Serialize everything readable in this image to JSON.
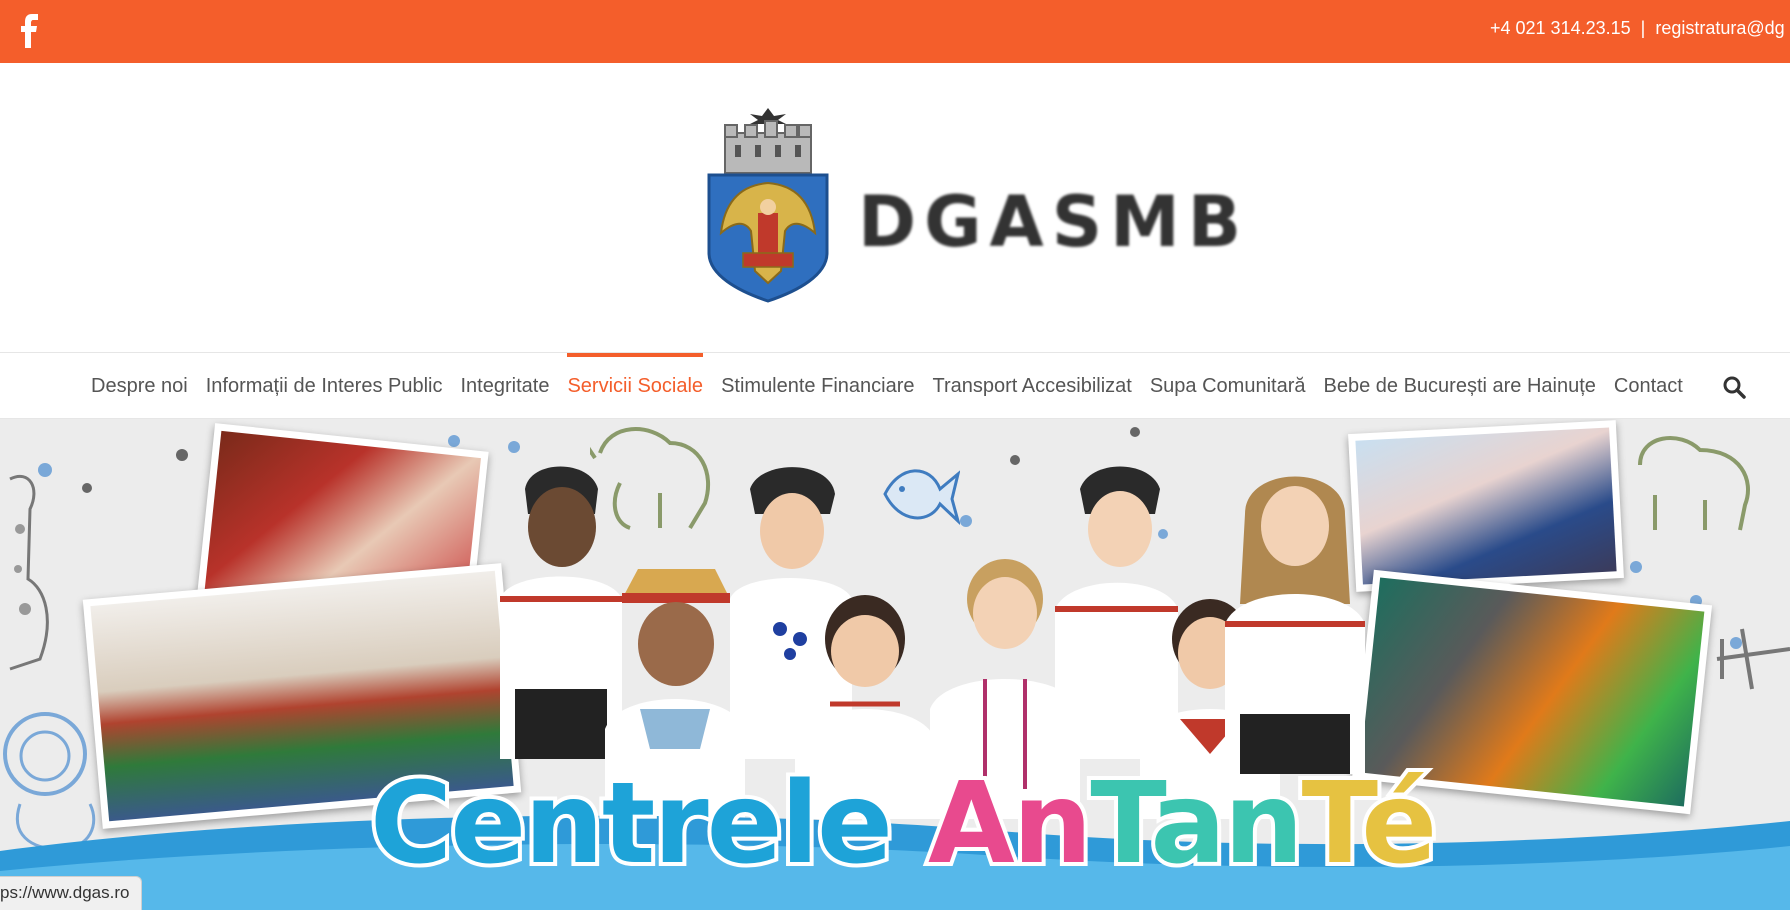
{
  "topbar": {
    "color": "#f45e2b",
    "facebook_icon": "facebook-icon",
    "phone": "+4 021 314.23.15",
    "separator": "|",
    "email": "registratura@dg"
  },
  "header": {
    "brand": "DGASMB",
    "logo_icon": "bucharest-coat-of-arms"
  },
  "nav": {
    "items": [
      {
        "label": "Despre noi",
        "active": false
      },
      {
        "label": "Informații de Interes Public",
        "active": false
      },
      {
        "label": "Integritate",
        "active": false
      },
      {
        "label": "Servicii Sociale",
        "active": true
      },
      {
        "label": "Stimulente Financiare",
        "active": false
      },
      {
        "label": "Transport Accesibilizat",
        "active": false
      },
      {
        "label": "Supa Comunitară",
        "active": false
      },
      {
        "label": "Bebe de București are Hainuțe",
        "active": false
      },
      {
        "label": "Contact",
        "active": false
      }
    ],
    "search_icon": "search-icon",
    "accent": "#f45e2b"
  },
  "hero": {
    "title_part1": "Centrele ",
    "title_part2": "An",
    "title_part3": "Tan",
    "title_part4": "Té"
  },
  "status": {
    "url": "ps://www.dgas.ro"
  }
}
